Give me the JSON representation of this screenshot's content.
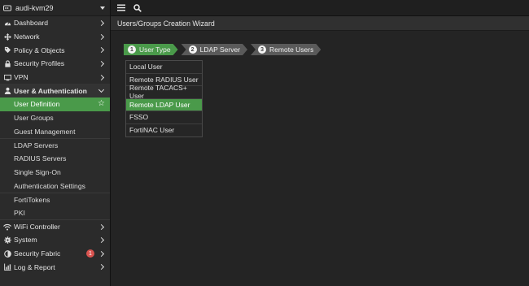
{
  "device": {
    "name": "audi-kvm29",
    "icon": "device-icon"
  },
  "topbar": {
    "menu_icon": "hamburger-icon",
    "search_icon": "search-icon"
  },
  "page": {
    "title": "Users/Groups Creation Wizard"
  },
  "nav": [
    {
      "label": "Dashboard",
      "icon": "dashboard-icon",
      "expandable": true
    },
    {
      "label": "Network",
      "icon": "network-icon",
      "expandable": true
    },
    {
      "label": "Policy & Objects",
      "icon": "policy-icon",
      "expandable": true
    },
    {
      "label": "Security Profiles",
      "icon": "lock-icon",
      "expandable": true
    },
    {
      "label": "VPN",
      "icon": "vpn-icon",
      "expandable": true
    },
    {
      "label": "User & Authentication",
      "icon": "user-icon",
      "expandable": true,
      "open": true
    }
  ],
  "user_auth_sub": [
    {
      "label": "User Definition",
      "active": true
    },
    {
      "label": "User Groups"
    },
    {
      "label": "Guest Management"
    },
    {
      "label": "LDAP Servers"
    },
    {
      "label": "RADIUS Servers"
    },
    {
      "label": "Single Sign-On"
    },
    {
      "label": "Authentication Settings"
    },
    {
      "label": "FortiTokens"
    },
    {
      "label": "PKI"
    }
  ],
  "nav_bottom": [
    {
      "label": "WiFi Controller",
      "icon": "wifi-icon"
    },
    {
      "label": "System",
      "icon": "gear-icon"
    },
    {
      "label": "Security Fabric",
      "icon": "fabric-icon",
      "badge": "1"
    },
    {
      "label": "Log & Report",
      "icon": "chart-icon"
    }
  ],
  "wizard_steps": [
    {
      "num": "1",
      "label": "User Type",
      "active": true
    },
    {
      "num": "2",
      "label": "LDAP Server"
    },
    {
      "num": "3",
      "label": "Remote Users"
    }
  ],
  "user_types": [
    {
      "label": "Local User"
    },
    {
      "label": "Remote RADIUS User"
    },
    {
      "label": "Remote TACACS+ User"
    },
    {
      "label": "Remote LDAP User",
      "selected": true
    },
    {
      "label": "FSSO"
    },
    {
      "label": "FortiNAC User"
    }
  ],
  "colors": {
    "accent": "#4a9a4a",
    "badge": "#d9534f",
    "sidebar": "#2b2b2b"
  }
}
